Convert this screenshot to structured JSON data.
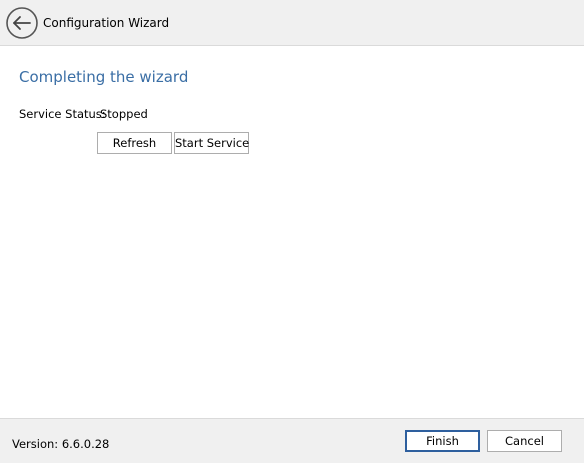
{
  "window": {
    "title": "Configuration Wizard"
  },
  "page": {
    "heading": "Completing the wizard",
    "service_status_label": "Service Status:",
    "service_status_value": "Stopped"
  },
  "actions": {
    "refresh_label": "Refresh",
    "start_service_label": "Start Service"
  },
  "footer": {
    "version_text": "Version: 6.6.0.28",
    "finish_label": "Finish",
    "cancel_label": "Cancel"
  },
  "icons": {
    "back": "back-arrow-icon"
  },
  "colors": {
    "heading": "#3a6ea5",
    "header_bg": "#f0f0f0",
    "default_button_border": "#2e5f9e"
  }
}
